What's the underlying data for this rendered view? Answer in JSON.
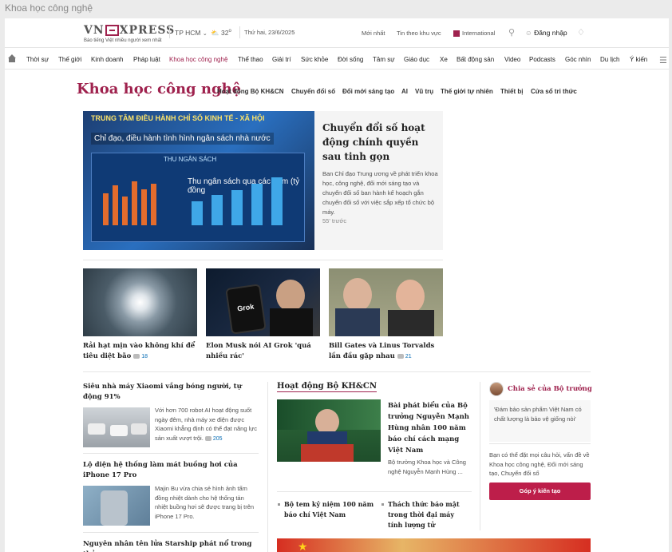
{
  "tab": {
    "title": "Khoa học công nghệ"
  },
  "topbar": {
    "logo_text": "VNEXPRESS",
    "slogan": "Báo tiếng Việt nhiều người xem nhất",
    "city": "TP HCM",
    "temp": "32",
    "date": "Thứ hai, 23/6/2025",
    "latest": "Mới nhất",
    "regional": "Tin theo khu vực",
    "international": "International",
    "login": "Đăng nhập"
  },
  "nav": {
    "items": [
      "Thời sự",
      "Thế giới",
      "Kinh doanh",
      "Pháp luật",
      "Khoa học công nghệ",
      "Thể thao",
      "Giải trí",
      "Sức khỏe",
      "Đời sống",
      "Tâm sự",
      "Giáo dục",
      "Xe",
      "Bất động sản",
      "Video",
      "Podcasts",
      "Góc nhìn",
      "Du lịch",
      "Ý kiến"
    ],
    "active": "Khoa học công nghệ"
  },
  "category": {
    "title": "Khoa học công nghệ",
    "subnav": [
      "Hoạt động Bộ KH&CN",
      "Chuyển đổi số",
      "Đổi mới sáng tạo",
      "AI",
      "Vũ trụ",
      "Thế giới tự nhiên",
      "Thiết bị",
      "Cửa sổ tri thức"
    ]
  },
  "hero": {
    "img_line1": "TRUNG TÂM ĐIỀU HÀNH CHỈ SỐ KINH TẾ - XÃ HỘI",
    "img_line2": "Chỉ đạo, điều hành tình hình ngân sách nhà nước",
    "img_line3": "THU NGÂN SÁCH",
    "img_line4": "Thu ngân sách qua các năm (tỷ đồng",
    "title": "Chuyển đổi số hoạt động chính quyền sau tinh gọn",
    "desc": "Ban Chỉ đạo Trung ương về phát triển khoa học, công nghệ, đổi mới sáng tạo và chuyển đổi số ban hành kế hoạch gắn chuyển đổi số với việc sắp xếp tổ chức bộ máy.",
    "time": "55' trước"
  },
  "cards": [
    {
      "title": "Rải hạt mịn vào không khí để tiêu diệt bão",
      "comments": "18"
    },
    {
      "title": "Elon Musk nói AI Grok 'quá nhiều rác'",
      "comments": "",
      "img_label": "Grok"
    },
    {
      "title": "Bill Gates và Linus Torvalds lần đầu gặp nhau",
      "comments": "21"
    }
  ],
  "left_list": [
    {
      "title": "Siêu nhà máy Xiaomi vắng bóng người, tự động 91%",
      "desc": "Với hơn 700 robot AI hoạt động suốt ngày đêm, nhà máy xe điện được Xiaomi khẳng định có thể đạt năng lực sản xuất vượt trội.",
      "comments": "205"
    },
    {
      "title": "Lộ diện hệ thống làm mát buồng hơi của iPhone 17 Pro",
      "desc": "Majin Bu vừa chia sẻ hình ảnh tấm đồng nhiệt dành cho hệ thống tản nhiệt buồng hơi sẽ được trang bị trên iPhone 17 Pro."
    },
    {
      "title": "Nguyên nhân tên lửa Starship phát nổ trong thử"
    }
  ],
  "mid": {
    "section": "Hoạt động Bộ KH&CN",
    "title": "Bài phát biểu của Bộ trưởng Nguyễn Mạnh Hùng nhân 100 năm báo chí cách mạng Việt Nam",
    "desc": "Bộ trưởng Khoa học và Công nghệ Nguyễn Mạnh Hùng ...",
    "bullets": [
      "Bộ tem kỷ niệm 100 năm báo chí Việt Nam",
      "Thách thức báo mật trong thời đại máy tính lượng tử"
    ]
  },
  "side": {
    "title": "Chia sẻ của Bộ trưởng",
    "quote": "'Đám bảo sản phẩm Việt Nam có chất lượng là bảo vệ giống nòi'",
    "desc": "Bạn có thể đặt mọi câu hỏi, vấn đề về Khoa học công nghệ, Đổi mới sáng tạo, Chuyển đổi số",
    "button": "Góp ý kiến tạo"
  },
  "colors": {
    "brand": "#9f224e",
    "button": "#bd1e4a",
    "comment": "#076db6"
  }
}
